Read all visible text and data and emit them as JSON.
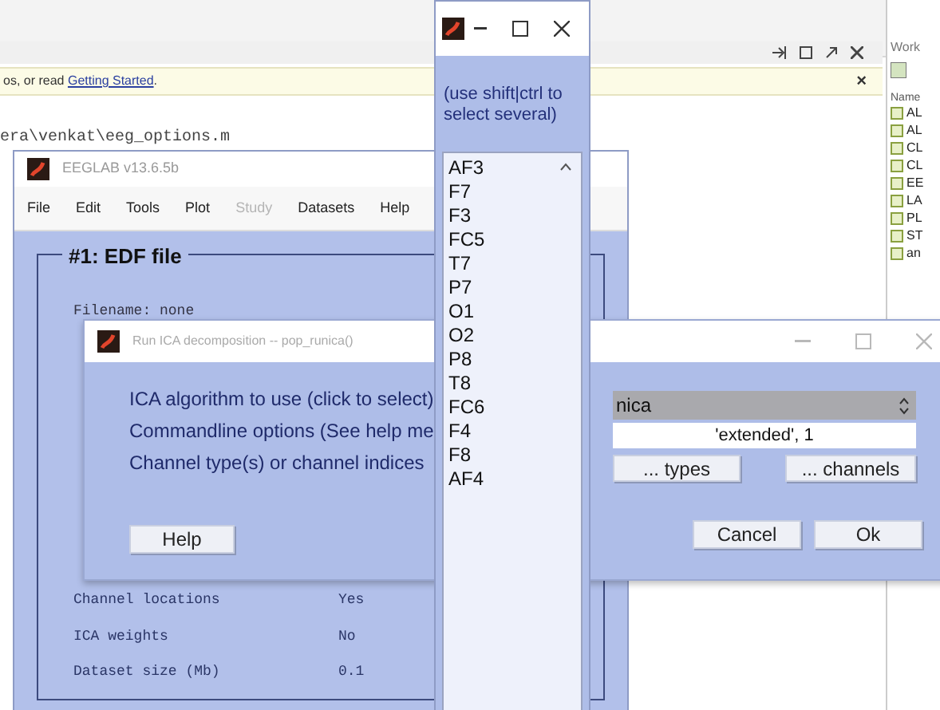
{
  "matlab": {
    "info_bar": {
      "text": "os, or read ",
      "link": "Getting Started",
      "end": ".",
      "close": "×"
    },
    "command_line": "era\\venkat\\eeg_options.m",
    "workspace": {
      "title": "Work",
      "column": "Name",
      "items": [
        "AL",
        "AL",
        "CL",
        "CL",
        "EE",
        "LA",
        "PL",
        "ST",
        "an"
      ]
    }
  },
  "eeglab": {
    "title": "EEGLAB v13.6.5b",
    "menu": [
      {
        "label": "File",
        "disabled": false
      },
      {
        "label": "Edit",
        "disabled": false
      },
      {
        "label": "Tools",
        "disabled": false
      },
      {
        "label": "Plot",
        "disabled": false
      },
      {
        "label": "Study",
        "disabled": true
      },
      {
        "label": "Datasets",
        "disabled": false
      },
      {
        "label": "Help",
        "disabled": false
      }
    ],
    "group_title": "#1: EDF file",
    "filename": "Filename: none",
    "rows": [
      {
        "label": "Channel locations",
        "value": "Yes"
      },
      {
        "label": "ICA weights",
        "value": "No"
      },
      {
        "label": "Dataset size (Mb)",
        "value": "0.1"
      }
    ]
  },
  "ica_dialog": {
    "title": "Run ICA decomposition -- pop_runica()",
    "labels": [
      "ICA algorithm to use (click to select)",
      "Commandline options (See help me",
      "Channel type(s) or channel indices"
    ],
    "algorithm": "nica",
    "options": "'extended', 1",
    "types_button": "... types",
    "channels_button": "... channels",
    "help_button": "Help",
    "cancel_button": "Cancel",
    "ok_button": "Ok"
  },
  "channel_picker": {
    "hint": "(use shift|ctrl to select several)",
    "channels": [
      "AF3",
      "F7",
      "F3",
      "FC5",
      "T7",
      "P7",
      "O1",
      "O2",
      "P8",
      "T8",
      "FC6",
      "F4",
      "F8",
      "AF4"
    ]
  }
}
